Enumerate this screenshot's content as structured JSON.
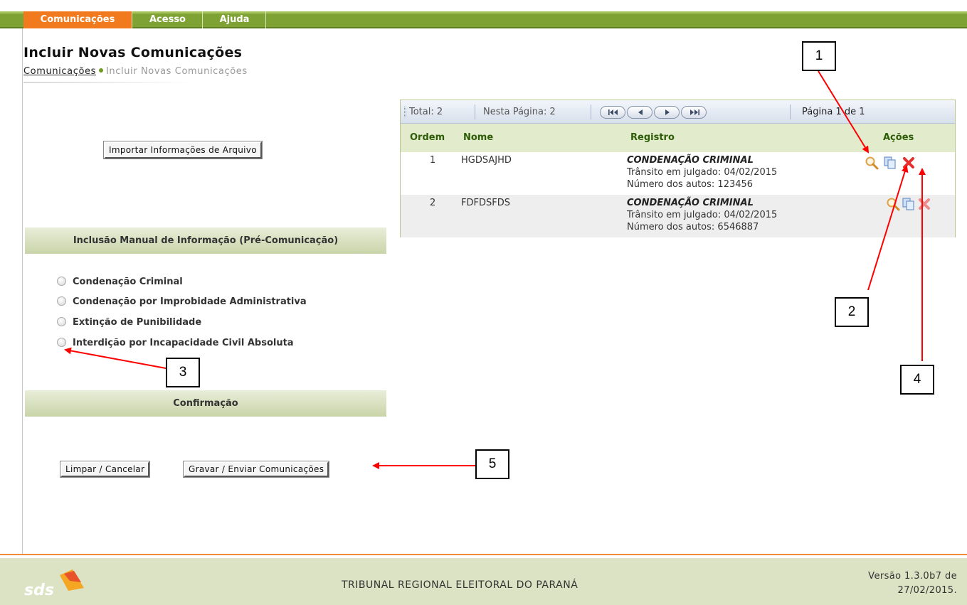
{
  "nav": {
    "tabs": [
      {
        "label": "Comunicações",
        "active": true
      },
      {
        "label": "Acesso",
        "active": false
      },
      {
        "label": "Ajuda",
        "active": false
      }
    ]
  },
  "header": {
    "title": "Incluir Novas Comunicações",
    "breadcrumb": {
      "link": "Comunicações",
      "current": "Incluir Novas Comunicações"
    }
  },
  "import_button": "Importar Informações de Arquivo",
  "manual_section": {
    "title": "Inclusão Manual de Informação (Pré-Comunicação)",
    "options": [
      "Condenação Criminal",
      "Condenação por Improbidade Administrativa",
      "Extinção de Punibilidade",
      "Interdição por Incapacidade Civil Absoluta"
    ]
  },
  "confirm_section": {
    "title": "Confirmação",
    "clear_button": "Limpar / Cancelar",
    "submit_button": "Gravar / Enviar Comunicações"
  },
  "grid": {
    "toolbar": {
      "total": "Total: 2",
      "on_page": "Nesta Página: 2",
      "page": "Página 1 de 1"
    },
    "columns": {
      "ordem": "Ordem",
      "nome": "Nome",
      "registro": "Registro",
      "acoes": "Ações"
    },
    "rows": [
      {
        "ordem": "1",
        "nome": "HGDSAJHD",
        "registro_tipo": "CONDENAÇÃO CRIMINAL",
        "transito": "Trânsito em julgado: 04/02/2015",
        "autos": "Número dos autos: 123456"
      },
      {
        "ordem": "2",
        "nome": "FDFDSFDS",
        "registro_tipo": "CONDENAÇÃO CRIMINAL",
        "transito": "Trânsito em julgado: 04/02/2015",
        "autos": "Número dos autos: 6546887"
      }
    ],
    "action_icons": [
      "magnifier-icon",
      "copy-icon",
      "delete-icon"
    ],
    "pager_icons": [
      "first-page-icon",
      "previous-page-icon",
      "next-page-icon",
      "last-page-icon"
    ]
  },
  "footer": {
    "logo_text": "sds",
    "institution": "TRIBUNAL REGIONAL ELEITORAL DO PARANÁ",
    "version_line1": "Versão 1.3.0b7 de",
    "version_line2": "27/02/2015."
  },
  "callouts": [
    "1",
    "2",
    "3",
    "4",
    "5"
  ],
  "colors": {
    "nav_green": "#7fa234",
    "nav_active": "#f07a1d",
    "header_green": "#2d5d06",
    "footer_bg": "#dce3c4",
    "annotation_red": "#ff0000"
  }
}
